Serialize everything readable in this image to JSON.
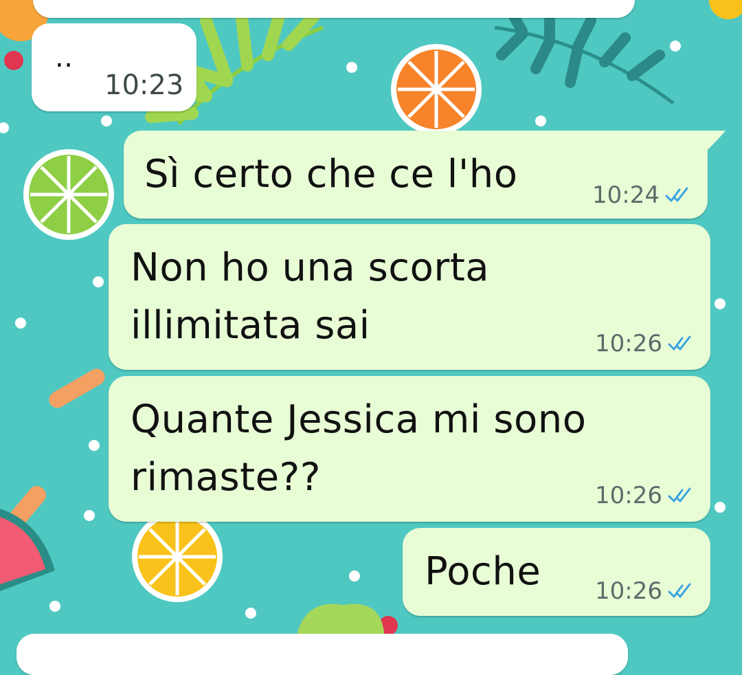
{
  "conversation": {
    "messages": [
      {
        "direction": "in",
        "text": "..",
        "time": "10:23"
      },
      {
        "direction": "out",
        "text": "Sì certo che ce l'ho",
        "time": "10:24",
        "status": "read"
      },
      {
        "direction": "out",
        "text": "Non ho una scorta\nillimitata sai",
        "time": "10:26",
        "status": "read"
      },
      {
        "direction": "out",
        "text": "Quante Jessica mi sono\nrimaste??",
        "time": "10:26",
        "status": "read"
      },
      {
        "direction": "out",
        "text": "Poche",
        "time": "10:26",
        "status": "read"
      }
    ]
  },
  "theme": {
    "wallpaper": "#4fc8c2",
    "incoming_bubble": "#ffffff",
    "outgoing_bubble": "#e8fcd6",
    "read_tick": "#3aa3e3",
    "time_text": "#5d6b6a"
  },
  "icons": {
    "read_receipt": "double-check-icon"
  }
}
